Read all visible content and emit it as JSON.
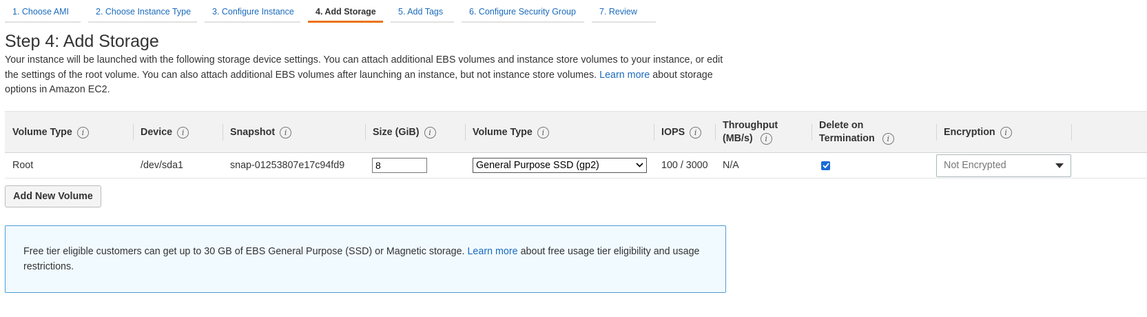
{
  "wizard": {
    "steps": [
      {
        "label": "1. Choose AMI"
      },
      {
        "label": "2. Choose Instance Type"
      },
      {
        "label": "3. Configure Instance"
      },
      {
        "label": "4. Add Storage"
      },
      {
        "label": "5. Add Tags"
      },
      {
        "label": "6. Configure Security Group"
      },
      {
        "label": "7. Review"
      }
    ],
    "active_index": 3,
    "accent_color": "#ec7211"
  },
  "page": {
    "title": "Step 4: Add Storage",
    "intro_before_link": "Your instance will be launched with the following storage device settings. You can attach additional EBS volumes and instance store volumes to your instance, or edit the settings of the root volume. You can also attach additional EBS volumes after launching an instance, but not instance store volumes.",
    "intro_link": "Learn more",
    "intro_after_link": "about storage options in Amazon EC2."
  },
  "table": {
    "headers": {
      "volume_type": "Volume Type",
      "device": "Device",
      "snapshot": "Snapshot",
      "size": "Size (GiB)",
      "volume_type2": "Volume Type",
      "iops": "IOPS",
      "throughput_line1": "Throughput",
      "throughput_line2": "(MB/s)",
      "delete_line1": "Delete on",
      "delete_line2": "Termination",
      "encryption": "Encryption"
    },
    "info_icon": "info-icon",
    "rows": [
      {
        "volume_type": "Root",
        "device": "/dev/sda1",
        "snapshot": "snap-01253807e17c94fd9",
        "size": "8",
        "ebs_volume_type": "General Purpose SSD (gp2)",
        "iops": "100 / 3000",
        "throughput": "N/A",
        "delete_on_termination": true,
        "encryption": "Not Encrypted"
      }
    ]
  },
  "actions": {
    "add_volume_label": "Add New Volume"
  },
  "notice": {
    "text_before_link": "Free tier eligible customers can get up to 30 GB of EBS General Purpose (SSD) or Magnetic storage.",
    "link": "Learn more",
    "text_after_link": "about free usage tier eligibility and usage restrictions.",
    "border_color": "#4c9ed4",
    "background_color": "#f1faff"
  },
  "colors": {
    "link": "#1a6bbd",
    "checkbox": "#1a6bd6"
  }
}
